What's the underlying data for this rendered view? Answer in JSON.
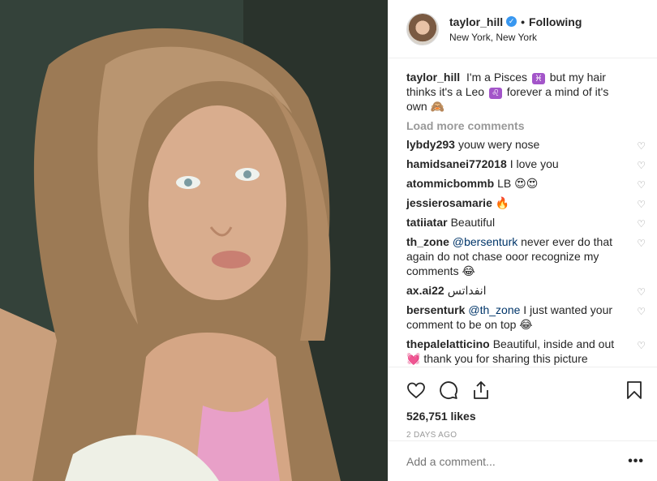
{
  "header": {
    "username": "taylor_hill",
    "separator": "•",
    "follow_label": "Following",
    "location": "New York, New York"
  },
  "caption": {
    "username": "taylor_hill",
    "text_a": "I'm a Pisces",
    "emoji_a": "♓",
    "text_b": "but my hair thinks it's a Leo",
    "emoji_b": "♌",
    "text_c": "forever a mind of it's own 🙈"
  },
  "load_more_label": "Load more comments",
  "comments": [
    {
      "user": "lybdy293",
      "text": "youw wery nose"
    },
    {
      "user": "hamidsanei772018",
      "text": "I love you"
    },
    {
      "user": "atommicbommb",
      "text": "LB 😍😍"
    },
    {
      "user": "jessierosamarie",
      "text": "🔥"
    },
    {
      "user": "tatiiatar",
      "text": "Beautiful"
    },
    {
      "user": "th_zone",
      "mention": "@bersenturk",
      "text": "never ever do that again do not chase ooor recognize my comments 😂"
    },
    {
      "user": "ax.ai22",
      "text": "انفداتس"
    },
    {
      "user": "bersenturk",
      "mention": "@th_zone",
      "text": "I just wanted your comment to be on top 😂"
    },
    {
      "user": "thepalelatticino",
      "text": "Beautiful, inside and out💓 thank you for sharing this picture"
    }
  ],
  "likes": "526,751 likes",
  "timestamp": "2 DAYS AGO",
  "add_comment": {
    "placeholder": "Add a comment...",
    "more_label": "•••"
  },
  "icons": [
    "heart-icon",
    "comment-icon",
    "share-icon",
    "bookmark-icon",
    "verified-badge-icon"
  ],
  "colors": {
    "verified": "#3897f0",
    "mention": "#003569",
    "muted": "#999999"
  }
}
